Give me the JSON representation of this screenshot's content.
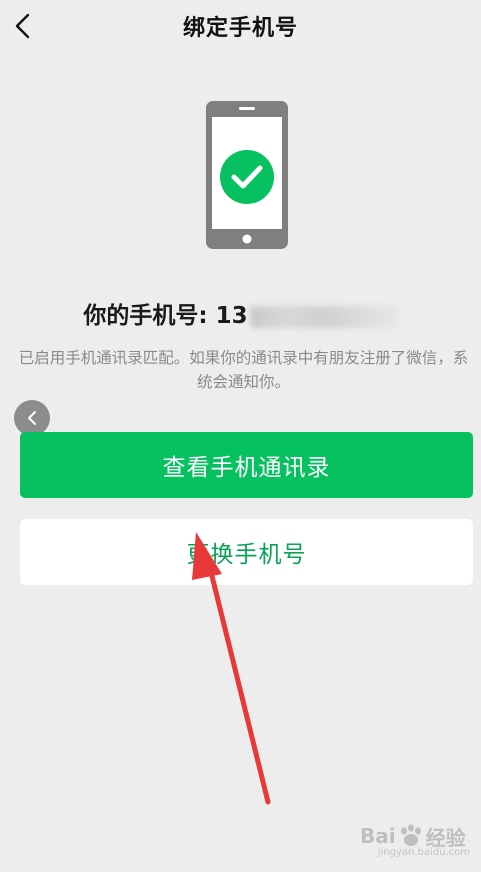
{
  "nav": {
    "title": "绑定手机号",
    "back_icon": "chevron-left-icon"
  },
  "illustration": {
    "icon": "phone-check-icon",
    "check_color": "#07c160",
    "phone_color": "#7f7f7f"
  },
  "phone": {
    "label": "你的手机号: 13"
  },
  "description": "已启用手机通讯录匹配。如果你的通讯录中有朋友注册了微信，系统会通知你。",
  "actions": {
    "view_contacts": "查看手机通讯录",
    "change_number": "更换手机号"
  },
  "watermark": {
    "text": "Bai",
    "text_end": "经验",
    "sub": "jingyan.baidu.com"
  },
  "colors": {
    "primary": "#07c160",
    "background": "#ededed",
    "arrow": "#e8393a"
  }
}
